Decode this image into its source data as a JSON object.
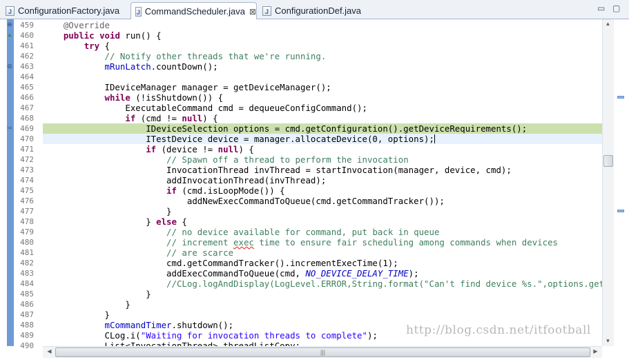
{
  "tabs": [
    {
      "label": "ConfigurationFactory.java",
      "icon": "java-file-icon",
      "icon_glyph": "J",
      "active": false
    },
    {
      "label": "CommandScheduler.java",
      "icon": "java-file-icon",
      "icon_glyph": "J",
      "active": true,
      "close_glyph": "⊠"
    },
    {
      "label": "ConfigurationDef.java",
      "icon": "java-file-icon",
      "icon_glyph": "J",
      "active": false
    }
  ],
  "window": {
    "minimize_glyph": "▭",
    "maximize_glyph": "▢"
  },
  "editor": {
    "current_line": "469",
    "cursor_line": "470",
    "lines": [
      {
        "n": "459",
        "fold": "⊖",
        "segs": [
          {
            "t": "    "
          },
          {
            "t": "@Override",
            "c": "an"
          }
        ]
      },
      {
        "n": "460",
        "mark": "▲",
        "segs": [
          {
            "t": "    "
          },
          {
            "t": "public",
            "c": "kw"
          },
          {
            "t": " "
          },
          {
            "t": "void",
            "c": "kw"
          },
          {
            "t": " run() {"
          }
        ]
      },
      {
        "n": "461",
        "segs": [
          {
            "t": "        "
          },
          {
            "t": "try",
            "c": "kw"
          },
          {
            "t": " {"
          }
        ]
      },
      {
        "n": "462",
        "segs": [
          {
            "t": "            "
          },
          {
            "t": "// Notify other threads that we're running.",
            "c": "cm"
          }
        ]
      },
      {
        "n": "463",
        "mark": "◎",
        "segs": [
          {
            "t": "            "
          },
          {
            "t": "mRunLatch",
            "c": "fd"
          },
          {
            "t": ".countDown();"
          }
        ]
      },
      {
        "n": "464",
        "segs": []
      },
      {
        "n": "465",
        "segs": [
          {
            "t": "            IDeviceManager manager = getDeviceManager();"
          }
        ]
      },
      {
        "n": "466",
        "segs": [
          {
            "t": "            "
          },
          {
            "t": "while",
            "c": "kw"
          },
          {
            "t": " (!isShutdown()) {"
          }
        ]
      },
      {
        "n": "467",
        "segs": [
          {
            "t": "                ExecutableCommand cmd = dequeueConfigCommand();"
          }
        ]
      },
      {
        "n": "468",
        "segs": [
          {
            "t": "                "
          },
          {
            "t": "if",
            "c": "kw"
          },
          {
            "t": " (cmd != "
          },
          {
            "t": "null",
            "c": "kw"
          },
          {
            "t": ") {"
          }
        ]
      },
      {
        "n": "469",
        "mark": "⇨",
        "segs": [
          {
            "t": "                    IDeviceSelection options = cmd.getConfiguration().getDeviceRequirements();"
          }
        ]
      },
      {
        "n": "470",
        "caret": true,
        "segs": [
          {
            "t": "                    ITestDevice device = manager.allocateDevice(0, options);"
          }
        ]
      },
      {
        "n": "471",
        "segs": [
          {
            "t": "                    "
          },
          {
            "t": "if",
            "c": "kw"
          },
          {
            "t": " (device != "
          },
          {
            "t": "null",
            "c": "kw"
          },
          {
            "t": ") {"
          }
        ]
      },
      {
        "n": "472",
        "segs": [
          {
            "t": "                        "
          },
          {
            "t": "// Spawn off a thread to perform the invocation",
            "c": "cm"
          }
        ]
      },
      {
        "n": "473",
        "segs": [
          {
            "t": "                        InvocationThread invThread = startInvocation(manager, device, cmd);"
          }
        ]
      },
      {
        "n": "474",
        "segs": [
          {
            "t": "                        addInvocationThread(invThread);"
          }
        ]
      },
      {
        "n": "475",
        "segs": [
          {
            "t": "                        "
          },
          {
            "t": "if",
            "c": "kw"
          },
          {
            "t": " (cmd.isLoopMode()) {"
          }
        ]
      },
      {
        "n": "476",
        "segs": [
          {
            "t": "                            addNewExecCommandToQueue(cmd.getCommandTracker());"
          }
        ]
      },
      {
        "n": "477",
        "segs": [
          {
            "t": "                        }"
          }
        ]
      },
      {
        "n": "478",
        "segs": [
          {
            "t": "                    } "
          },
          {
            "t": "else",
            "c": "kw"
          },
          {
            "t": " {"
          }
        ]
      },
      {
        "n": "479",
        "segs": [
          {
            "t": "                        "
          },
          {
            "t": "// no device available for command, put back in queue",
            "c": "cm"
          }
        ]
      },
      {
        "n": "480",
        "segs": [
          {
            "t": "                        "
          },
          {
            "t": "// increment ",
            "c": "cm"
          },
          {
            "t": "exec",
            "c": "cm sq"
          },
          {
            "t": " time to ensure fair scheduling among commands when devices",
            "c": "cm"
          }
        ]
      },
      {
        "n": "481",
        "segs": [
          {
            "t": "                        "
          },
          {
            "t": "// are scarce",
            "c": "cm"
          }
        ]
      },
      {
        "n": "482",
        "segs": [
          {
            "t": "                        cmd.getCommandTracker().incrementExecTime(1);"
          }
        ]
      },
      {
        "n": "483",
        "segs": [
          {
            "t": "                        addExecCommandToQueue(cmd, "
          },
          {
            "t": "NO_DEVICE_DELAY_TIME",
            "c": "sc"
          },
          {
            "t": ");"
          }
        ]
      },
      {
        "n": "484",
        "segs": [
          {
            "t": "                        "
          },
          {
            "t": "//CLog.logAndDisplay(LogLevel.ERROR,String.format(\"Can't find device %s.\",options.getSerials",
            "c": "cm"
          }
        ]
      },
      {
        "n": "485",
        "segs": [
          {
            "t": "                    }"
          }
        ]
      },
      {
        "n": "486",
        "segs": [
          {
            "t": "                }"
          }
        ]
      },
      {
        "n": "487",
        "segs": [
          {
            "t": "            }"
          }
        ]
      },
      {
        "n": "488",
        "segs": [
          {
            "t": "            "
          },
          {
            "t": "mCommandTimer",
            "c": "fd"
          },
          {
            "t": ".shutdown();"
          }
        ]
      },
      {
        "n": "489",
        "segs": [
          {
            "t": "            CLog.i("
          },
          {
            "t": "\"Waiting for invocation threads to complete\"",
            "c": "st"
          },
          {
            "t": ");"
          }
        ]
      },
      {
        "n": "490",
        "segs": [
          {
            "t": "            List<InvocationThread> threadListCopy;"
          }
        ]
      }
    ]
  },
  "vscroll": {
    "up_glyph": "▲",
    "down_glyph": "▼"
  },
  "hscroll": {
    "left_glyph": "◀",
    "right_glyph": "▶",
    "grip_glyph": "|||"
  },
  "watermark": "http://blog.csdn.net/itfootball",
  "colors": {
    "keyword": "#7f0055",
    "comment": "#3f7f5f",
    "field": "#0000c0",
    "string": "#2a00ff",
    "current_line_bg": "#cce0ae",
    "cursor_line_bg": "#e8f2fe",
    "ruler_stripe": "#6e9bd6"
  }
}
